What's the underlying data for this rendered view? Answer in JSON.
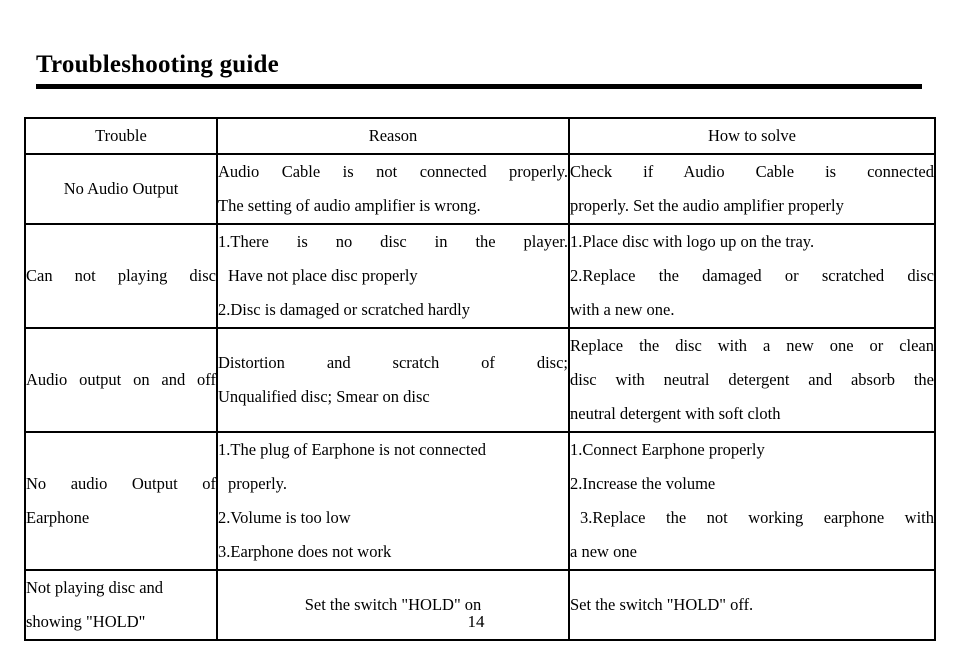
{
  "document": {
    "title": "Troubleshooting guide",
    "page_number": "14"
  },
  "table": {
    "headers": {
      "trouble": "Trouble",
      "reason": "Reason",
      "solve": "How to solve"
    },
    "rows": [
      {
        "trouble": "No Audio Output",
        "reason_lines": [
          "Audio Cable is not connected properly.",
          "The setting of audio amplifier is wrong."
        ],
        "solve_lines": [
          "Check if Audio Cable is connected",
          "properly. Set the audio amplifier properly"
        ]
      },
      {
        "trouble": "Can not playing disc",
        "reason_lines": [
          "1.There is no disc in the player.",
          "Have not place disc properly",
          "2.Disc is damaged or scratched hardly"
        ],
        "solve_lines": [
          "1.Place disc with logo up on the tray.",
          "2.Replace the damaged or scratched disc",
          "with a new one."
        ]
      },
      {
        "trouble": "Audio output on and off",
        "reason_lines": [
          "Distortion and scratch of disc;",
          "Unqualified disc; Smear on disc"
        ],
        "solve_lines": [
          "Replace the disc with a new one or clean",
          "disc with neutral detergent and absorb the",
          "neutral detergent with soft cloth"
        ]
      },
      {
        "trouble": "No audio Output of Earphone",
        "reason_lines": [
          "1.The plug of Earphone is not connected",
          "properly.",
          "2.Volume is too low",
          "3.Earphone does not work"
        ],
        "solve_lines": [
          "1.Connect Earphone properly",
          "2.Increase the volume",
          "3.Replace the not working earphone with",
          "a new one"
        ]
      },
      {
        "trouble": "Not playing disc and showing \"HOLD\"",
        "reason_lines": [
          "Set the switch \"HOLD\" on"
        ],
        "solve_lines": [
          "Set the switch \"HOLD\" off."
        ]
      }
    ]
  }
}
